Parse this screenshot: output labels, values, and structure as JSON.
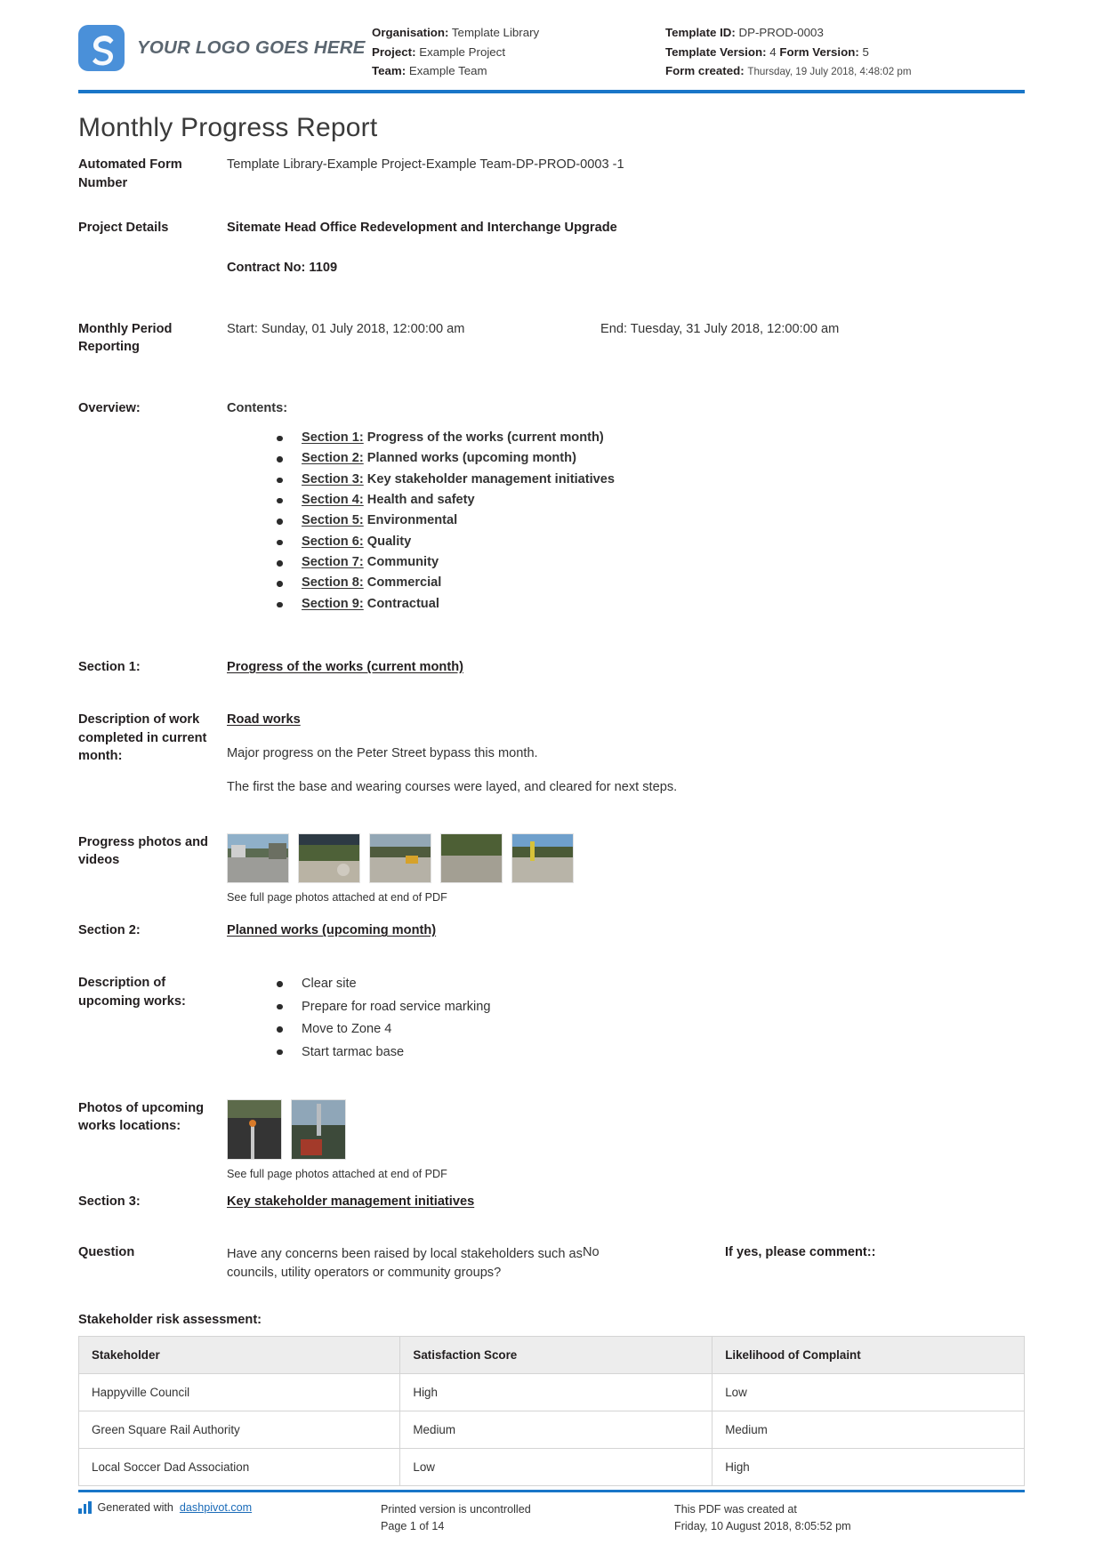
{
  "header": {
    "logo_text": "YOUR LOGO GOES HERE",
    "left": {
      "organisation_label": "Organisation:",
      "organisation_value": "Template Library",
      "project_label": "Project:",
      "project_value": "Example Project",
      "team_label": "Team:",
      "team_value": "Example Team"
    },
    "right": {
      "template_id_label": "Template ID:",
      "template_id_value": "DP-PROD-0003",
      "template_version_label": "Template Version:",
      "template_version_value": "4",
      "form_version_label": "Form Version:",
      "form_version_value": "5",
      "form_created_label": "Form created:",
      "form_created_value": "Thursday, 19 July 2018, 4:48:02 pm"
    }
  },
  "document": {
    "title": "Monthly Progress Report",
    "automated_form_number_label": "Automated Form Number",
    "automated_form_number_value": "Template Library-Example Project-Example Team-DP-PROD-0003   -1",
    "project_details_label": "Project Details",
    "project_details_value": "Sitemate Head Office Redevelopment and Interchange Upgrade",
    "contract_no": "Contract No: 1109",
    "period_label": "Monthly Period Reporting",
    "period_start": "Start: Sunday, 01 July 2018, 12:00:00 am",
    "period_end": "End: Tuesday, 31 July 2018, 12:00:00 am",
    "overview_label": "Overview:",
    "contents_heading": "Contents:",
    "contents": [
      {
        "prefix": "Section 1:",
        "text": " Progress of the works (current month)"
      },
      {
        "prefix": "Section 2:",
        "text": " Planned works (upcoming month)"
      },
      {
        "prefix": "Section 3:",
        "text": " Key stakeholder management initiatives"
      },
      {
        "prefix": "Section 4:",
        "text": " Health and safety"
      },
      {
        "prefix": "Section 5:",
        "text": " Environmental"
      },
      {
        "prefix": "Section 6:",
        "text": " Quality"
      },
      {
        "prefix": "Section 7:",
        "text": " Community"
      },
      {
        "prefix": "Section 8:",
        "text": " Commercial"
      },
      {
        "prefix": "Section 9:",
        "text": " Contractual"
      }
    ]
  },
  "section1": {
    "label": "Section 1:",
    "heading": "Progress of the works (current month)",
    "description_label": "Description of work completed in current month:",
    "subheading": "Road works",
    "para1": "Major progress on the Peter Street bypass this month.",
    "para2": "The first the base and wearing courses were layed, and cleared for next steps.",
    "photos_label": "Progress photos and videos",
    "photo_caption": "See full page photos attached at end of PDF",
    "photo_count": 5
  },
  "section2": {
    "label": "Section 2:",
    "heading": "Planned works (upcoming month)",
    "description_label": "Description of upcoming works:",
    "items": [
      "Clear site",
      "Prepare for road service marking",
      "Move to Zone 4",
      "Start tarmac base"
    ],
    "photos_label": "Photos of upcoming works locations:",
    "photo_caption": "See full page photos attached at end of PDF",
    "photo_count": 2
  },
  "section3": {
    "label": "Section 3:",
    "heading": "Key stakeholder management initiatives",
    "question_label": "Question",
    "question_text": "Have any concerns been raised by local stakeholders such as councils, utility operators or community groups?",
    "answer": "No",
    "comment_label": "If yes, please comment::",
    "table_title": "Stakeholder risk assessment:",
    "table": {
      "columns": [
        "Stakeholder",
        "Satisfaction Score",
        "Likelihood of Complaint"
      ],
      "rows": [
        [
          "Happyville Council",
          "High",
          "Low"
        ],
        [
          "Green Square Rail Authority",
          "Medium",
          "Medium"
        ],
        [
          "Local Soccer Dad Association",
          "Low",
          "High"
        ]
      ]
    }
  },
  "footer": {
    "generated_prefix": "Generated with ",
    "generated_link": "dashpivot.com",
    "uncontrolled": "Printed version is uncontrolled",
    "page_number": "Page 1 of 14",
    "created_label": "This PDF was created at",
    "created_value": "Friday, 10 August 2018, 8:05:52 pm"
  },
  "theme": {
    "accent": "#1976c8",
    "table_header_bg": "#ededed",
    "link": "#1a6bb8"
  }
}
